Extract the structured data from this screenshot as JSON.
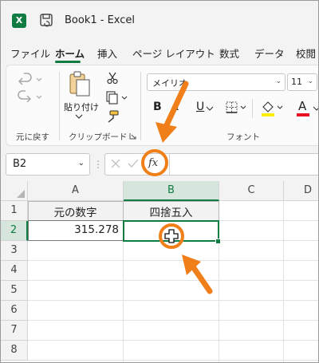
{
  "window": {
    "app_icon": "X",
    "title": "Book1  -  Excel"
  },
  "tabs": [
    "ファイル",
    "ホーム",
    "挿入",
    "ページ レイアウト",
    "数式",
    "データ",
    "校閲"
  ],
  "ribbon": {
    "undo_group_label": "元に戻す",
    "paste_label": "貼り付け",
    "clipboard_group_label": "クリップボード",
    "font_group_label": "フォント",
    "font_name": "メイリオ",
    "font_size": "11",
    "bold": "B",
    "italic": "I",
    "underline": "U",
    "font_color_glyph": "A",
    "font_color": "#e81123",
    "highlight_color": "#ffee00"
  },
  "formula_bar": {
    "name_box": "B2",
    "fx_label": "fx",
    "content": ""
  },
  "sheet": {
    "columns": [
      "A",
      "B",
      "C",
      "D"
    ],
    "rows": [
      "1",
      "2",
      "3",
      "4",
      "5",
      "6",
      "7",
      "8"
    ],
    "selected_cell": "B2",
    "cells": {
      "A1": "元の数字",
      "B1": "四捨五入",
      "A2": "315.278",
      "B2": ""
    }
  },
  "colors": {
    "accent_green": "#107c41",
    "callout_orange": "#f07f1a"
  }
}
